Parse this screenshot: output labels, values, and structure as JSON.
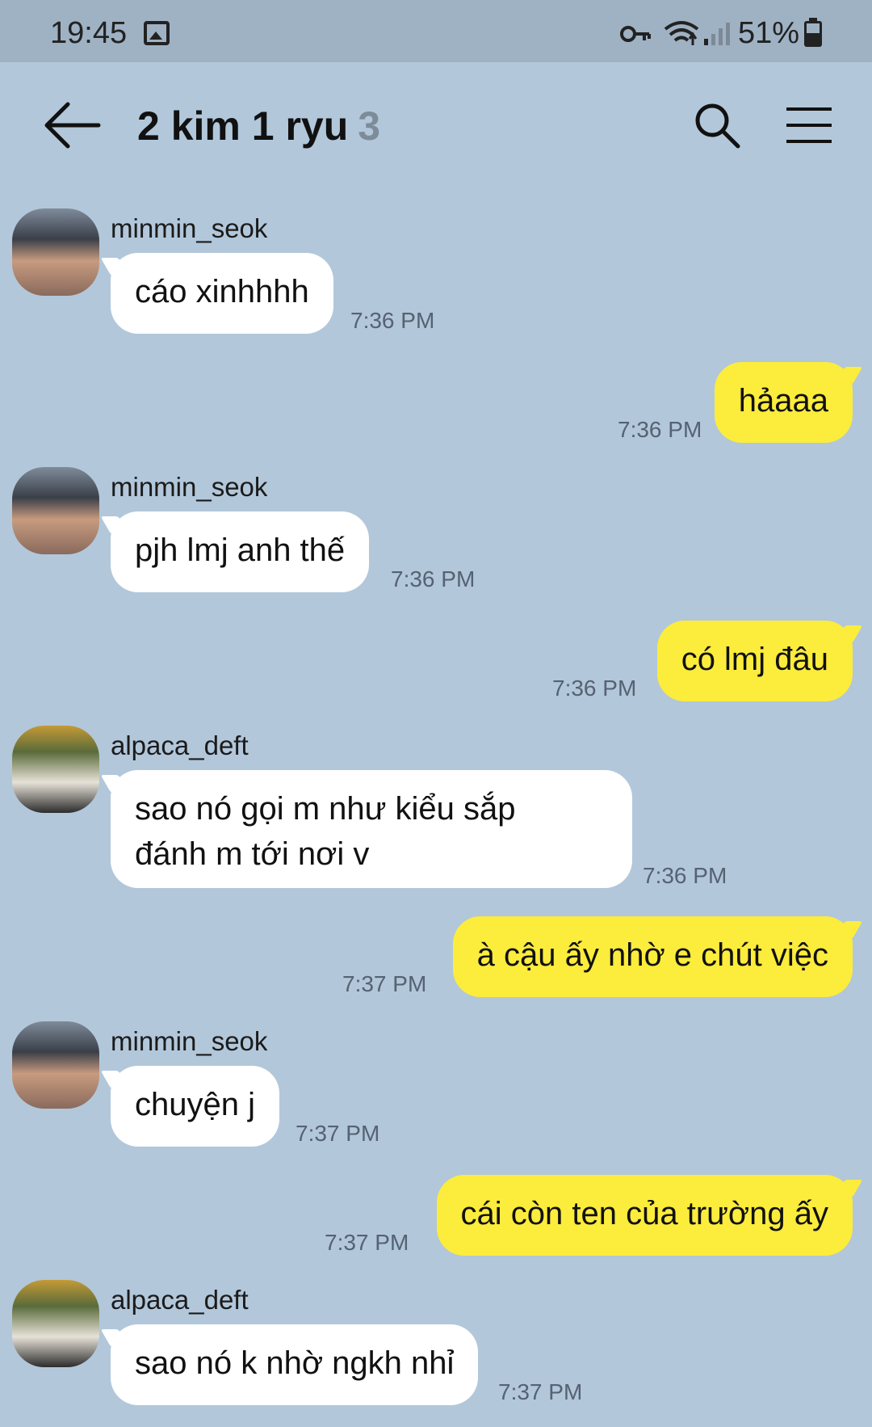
{
  "status_bar": {
    "time": "19:45",
    "battery": "51%",
    "icons": [
      "gallery-icon",
      "vpn-key-icon",
      "wifi-icon",
      "signal-icon",
      "battery-icon"
    ]
  },
  "header": {
    "title": "2 kim 1 ryu",
    "member_count": "3",
    "icons": [
      "back-arrow-icon",
      "search-icon",
      "menu-icon"
    ]
  },
  "colors": {
    "background": "#b2c7da",
    "incoming_bubble": "#ffffff",
    "outgoing_bubble": "#fcec3c"
  },
  "messages": [
    {
      "sender": "minmin_seok",
      "text": "cáo xinhhhh",
      "time": "7:36 PM"
    },
    {
      "text": "hảaaa",
      "time": "7:36 PM"
    },
    {
      "sender": "minmin_seok",
      "text": "pjh lmj anh thế",
      "time": "7:36 PM"
    },
    {
      "text": "có lmj đâu",
      "time": "7:36 PM"
    },
    {
      "sender": "alpaca_deft",
      "text_line1": "sao nó gọi m như kiểu sắp",
      "text_line2": "đánh m tới nơi v",
      "time": "7:36 PM"
    },
    {
      "text": "à cậu ấy nhờ e chút việc",
      "time": "7:37 PM"
    },
    {
      "sender": "minmin_seok",
      "text": "chuyện j",
      "time": "7:37 PM"
    },
    {
      "text": "cái còn ten của trường ấy",
      "time": "7:37 PM"
    },
    {
      "sender": "alpaca_deft",
      "text": "sao nó k nhờ ngkh nhỉ",
      "time": "7:37 PM"
    }
  ]
}
